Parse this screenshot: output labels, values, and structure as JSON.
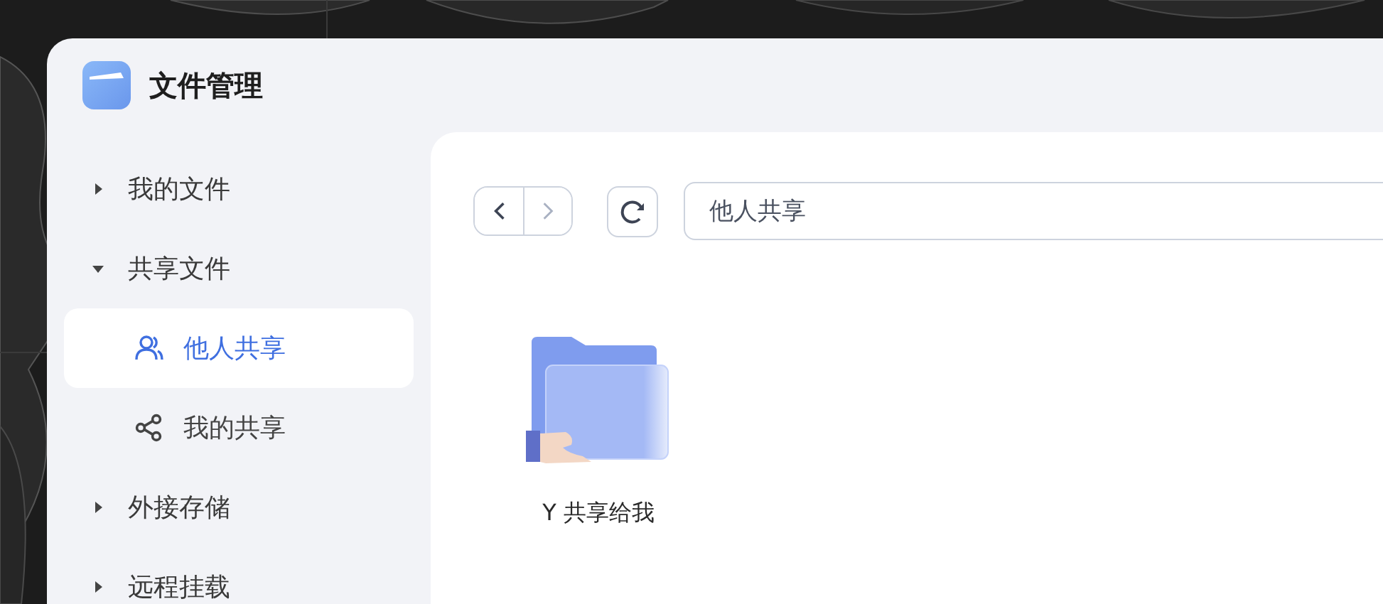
{
  "window": {
    "title": "文件管理"
  },
  "sidebar": {
    "items": [
      {
        "label": "我的文件",
        "expanded": false
      },
      {
        "label": "共享文件",
        "expanded": true,
        "children": [
          {
            "label": "他人共享",
            "selected": true
          },
          {
            "label": "我的共享",
            "selected": false
          }
        ]
      },
      {
        "label": "外接存储",
        "expanded": false
      },
      {
        "label": "远程挂载",
        "expanded": false
      }
    ]
  },
  "toolbar": {
    "back": {
      "disabled": false
    },
    "forward": {
      "disabled": true
    },
    "path": "他人共享"
  },
  "files": [
    {
      "name": "Y 共享给我",
      "kind": "shared-folder"
    }
  ]
}
